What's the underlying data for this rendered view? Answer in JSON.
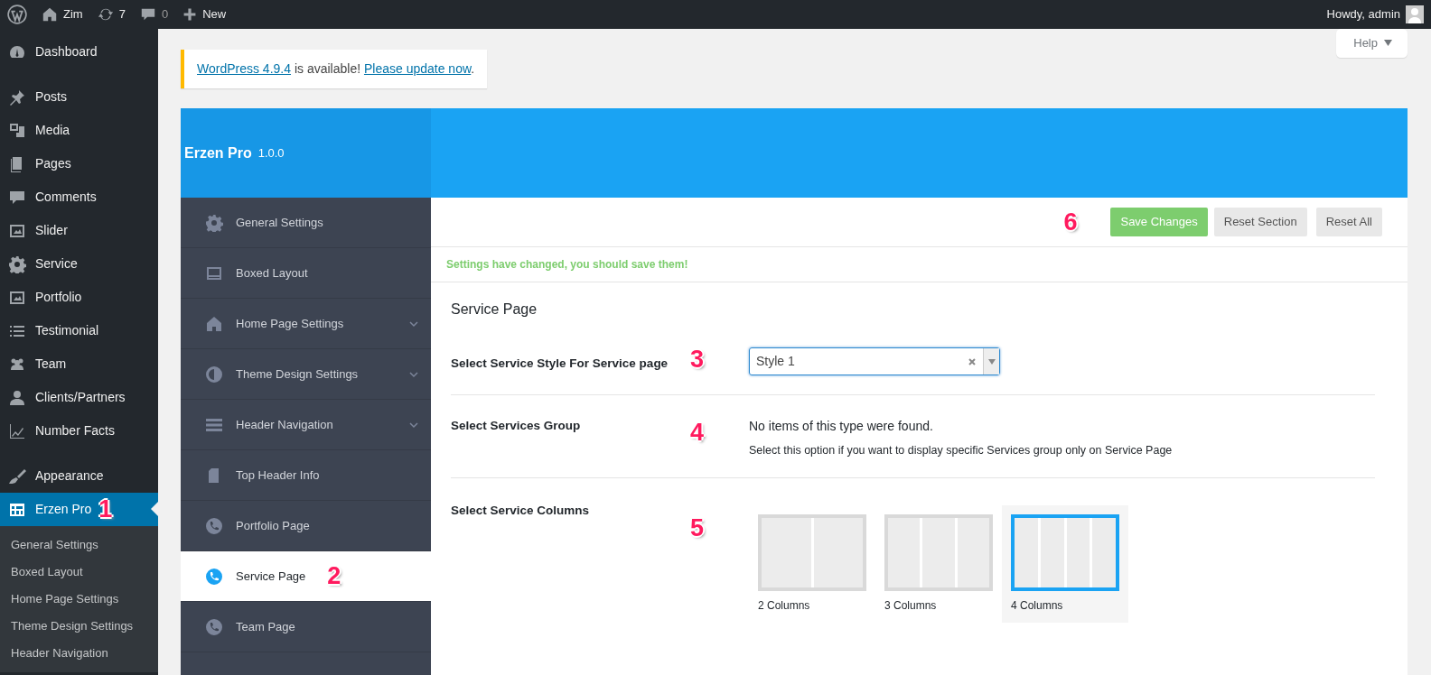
{
  "admin_bar": {
    "site": "Zim",
    "updates": "7",
    "comments": "0",
    "new": "New",
    "greeting": "Howdy, admin"
  },
  "admin_menu": {
    "groups": [
      [
        {
          "label": "Dashboard",
          "selected": false
        }
      ],
      [
        {
          "label": "Posts",
          "selected": false
        },
        {
          "label": "Media",
          "selected": false
        },
        {
          "label": "Pages",
          "selected": false
        },
        {
          "label": "Comments",
          "selected": false
        },
        {
          "label": "Slider",
          "selected": false
        },
        {
          "label": "Service",
          "selected": false
        },
        {
          "label": "Portfolio",
          "selected": false
        },
        {
          "label": "Testimonial",
          "selected": false
        },
        {
          "label": "Team",
          "selected": false
        },
        {
          "label": "Clients/Partners",
          "selected": false
        },
        {
          "label": "Number Facts",
          "selected": false
        }
      ],
      [
        {
          "label": "Appearance",
          "selected": false
        },
        {
          "label": "Erzen Pro",
          "selected": true,
          "marker": "1"
        }
      ]
    ],
    "submenu": [
      "General Settings",
      "Boxed Layout",
      "Home Page Settings",
      "Theme Design Settings",
      "Header Navigation"
    ]
  },
  "help_tab": {
    "label": "Help"
  },
  "notice": {
    "link": "WordPress 4.9.4",
    "text": " is available! ",
    "action": "Please update now",
    "end": "."
  },
  "panel": {
    "title": "Erzen Pro",
    "version": "1.0.0",
    "sections": [
      {
        "label": "General Settings",
        "selected": false,
        "has_children": false
      },
      {
        "label": "Boxed Layout",
        "selected": false,
        "has_children": false
      },
      {
        "label": "Home Page Settings",
        "selected": false,
        "has_children": true
      },
      {
        "label": "Theme Design Settings",
        "selected": false,
        "has_children": true
      },
      {
        "label": "Header Navigation",
        "selected": false,
        "has_children": true
      },
      {
        "label": "Top Header Info",
        "selected": false,
        "has_children": false
      },
      {
        "label": "Portfolio Page",
        "selected": false,
        "has_children": false
      },
      {
        "label": "Service Page",
        "selected": true,
        "has_children": false,
        "marker": "2"
      },
      {
        "label": "Team Page",
        "selected": false,
        "has_children": false
      }
    ],
    "save_marker": "6",
    "buttons": [
      {
        "label": "Save Changes",
        "kind": "primary"
      },
      {
        "label": "Reset Section",
        "kind": "secondary"
      },
      {
        "label": "Reset All",
        "kind": "secondary"
      }
    ],
    "change_notice": "Settings have changed, you should save them!",
    "section_title": "Service Page",
    "fields": [
      {
        "kind": "select",
        "label": "Select Service Style For Service page",
        "marker": "3",
        "value": "Style 1",
        "focused": true
      },
      {
        "kind": "message",
        "label": "Select Services Group",
        "marker": "4",
        "message": "No items of this type were found.",
        "description": "Select this option if you want to display specific Services group only on Service Page"
      },
      {
        "kind": "image_select",
        "label": "Select Service Columns",
        "marker": "5",
        "options": [
          {
            "label": "2 Columns",
            "selected": false
          },
          {
            "label": "3 Columns",
            "selected": false
          },
          {
            "label": "4 Columns",
            "selected": true
          }
        ]
      }
    ]
  }
}
